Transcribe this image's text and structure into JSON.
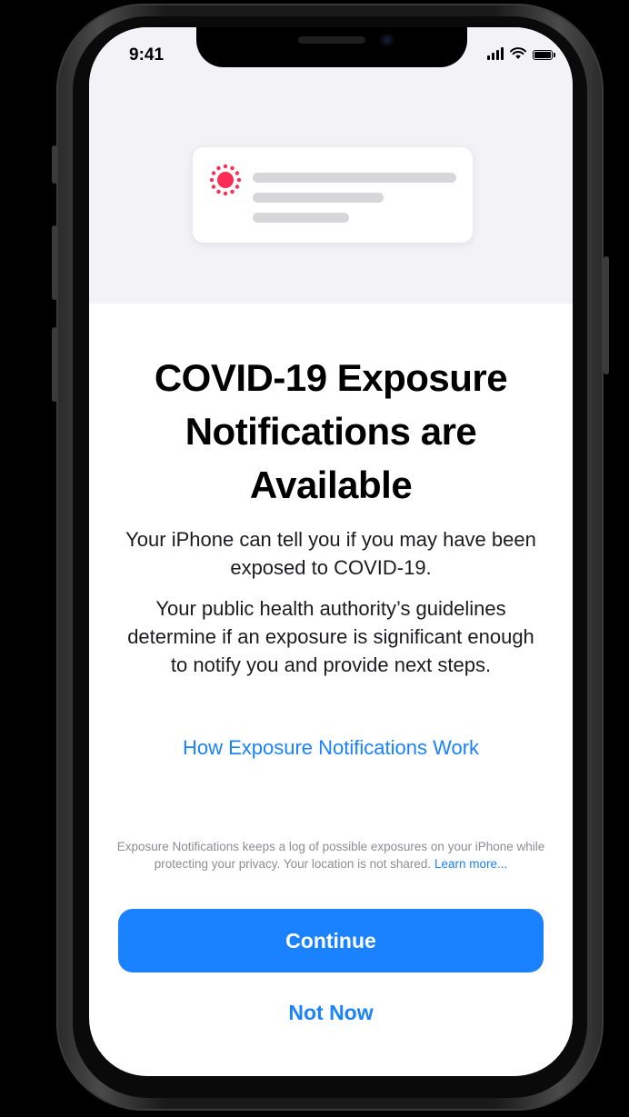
{
  "status_bar": {
    "time": "9:41",
    "signal_icon": "cellular-signal-icon",
    "wifi_icon": "wifi-icon",
    "battery_icon": "battery-icon",
    "battery_level": 1.0
  },
  "header_illustration": {
    "icon": "exposure-notification-icon",
    "icon_color": "#ff2d55",
    "placeholder_line_color": "#d6d6db"
  },
  "main": {
    "title": "COVID-19 Exposure Notifications are Available",
    "paragraph_1": "Your iPhone can tell you if you may have been exposed to COVID-19.",
    "paragraph_2": "Your public health authority’s guidelines determine if an exposure is significant enough to notify you and provide next steps.",
    "how_it_works_link": "How Exposure Notifications Work"
  },
  "footer": {
    "fine_print": "Exposure Notifications keeps a log of possible exposures on your iPhone while protecting your privacy. Your location is not shared.",
    "learn_more_link": "Learn more...",
    "continue_label": "Continue",
    "not_now_label": "Not Now"
  },
  "colors": {
    "accent": "#1a82ff",
    "header_background": "#f2f2f7",
    "frame": "#1a1a1a"
  }
}
